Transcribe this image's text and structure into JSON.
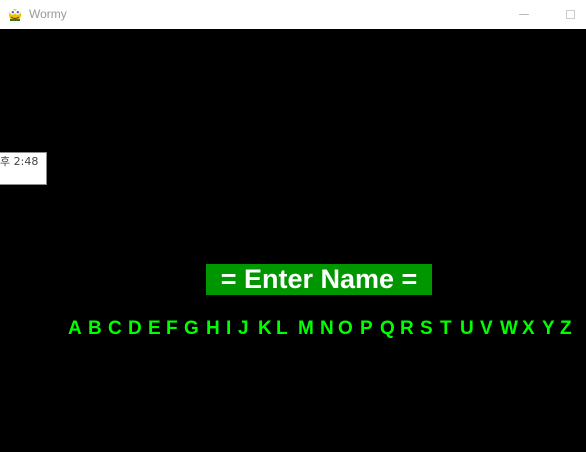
{
  "window": {
    "title": "Wormy",
    "icon": "pygame-snake-icon",
    "controls": [
      "minimize-icon",
      "maximize-icon"
    ]
  },
  "tooltip": {
    "text": "후 2:48"
  },
  "banner": {
    "text": "= Enter Name ="
  },
  "alphabet": [
    "A",
    "B",
    "C",
    "D",
    "E",
    "F",
    "G",
    "H",
    "I",
    "J",
    "K",
    "L",
    "M",
    "N",
    "O",
    "P",
    "Q",
    "R",
    "S",
    "T",
    "U",
    "V",
    "W",
    "X",
    "Y",
    "Z"
  ],
  "colors": {
    "background": "#000000",
    "banner_bg": "#009600",
    "banner_text": "#ffffff",
    "letters": "#00ff00",
    "titlebar": "#ffffff"
  }
}
